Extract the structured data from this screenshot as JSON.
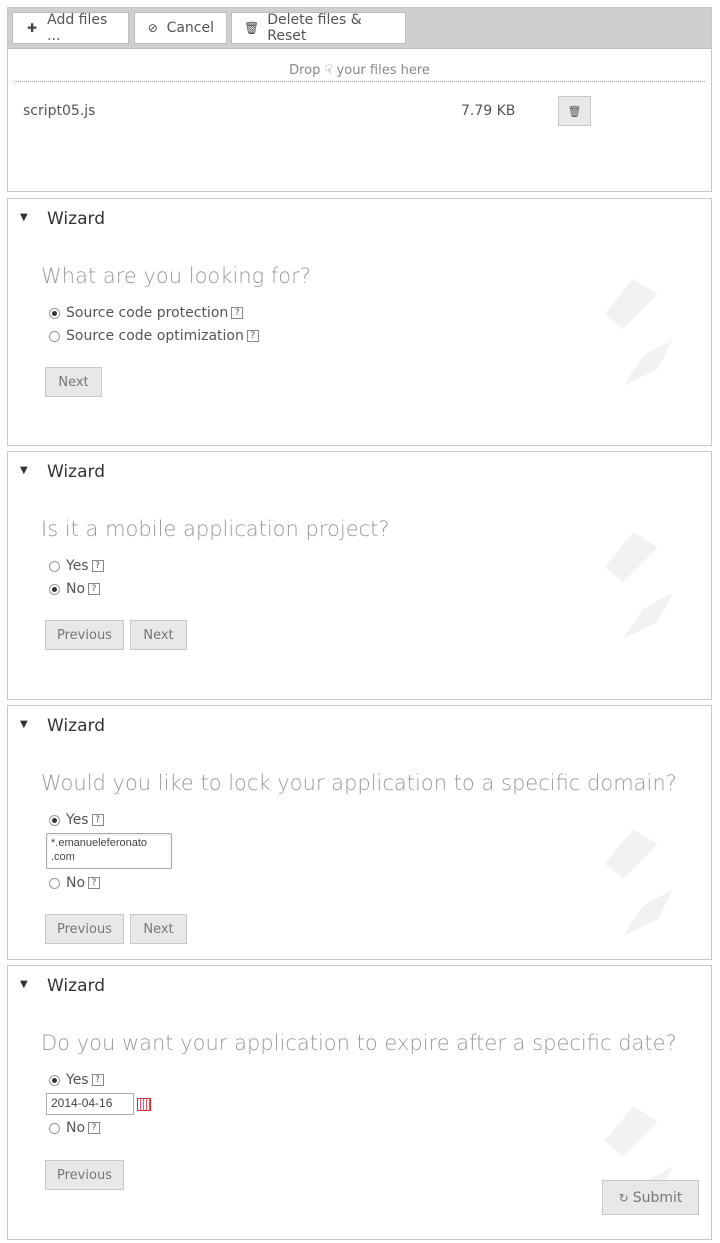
{
  "uploader": {
    "add_label": "Add files ...",
    "cancel_label": "Cancel",
    "reset_label": "Delete files & Reset",
    "drop_before": "Drop",
    "drop_after": "your files here",
    "file": {
      "name": "script05.js",
      "size": "7.79 KB"
    }
  },
  "wizards": [
    {
      "title": "Wizard",
      "question": "What are you looking for?",
      "options": [
        "Source code protection",
        "Source code optimization"
      ],
      "selected": 0,
      "next_label": "Next"
    },
    {
      "title": "Wizard",
      "question": "Is it a mobile application project?",
      "options": [
        "Yes",
        "No"
      ],
      "selected": 1,
      "prev_label": "Previous",
      "next_label": "Next"
    },
    {
      "title": "Wizard",
      "question": "Would you like to lock your application to a specific domain?",
      "options": [
        "Yes",
        "No"
      ],
      "selected": 0,
      "domain_value": "*.emanueleferonato\n.com",
      "prev_label": "Previous",
      "next_label": "Next"
    },
    {
      "title": "Wizard",
      "question": "Do you want your application to expire after a specific date?",
      "options": [
        "Yes",
        "No"
      ],
      "selected": 0,
      "date_value": "2014-04-16",
      "prev_label": "Previous",
      "submit_label": "Submit"
    }
  ],
  "help_glyph": "?",
  "colors": {
    "toolbar": "#cfcfcf",
    "button": "#e8e8e8",
    "question": "#999999",
    "watermark": "#f3f3f3"
  }
}
